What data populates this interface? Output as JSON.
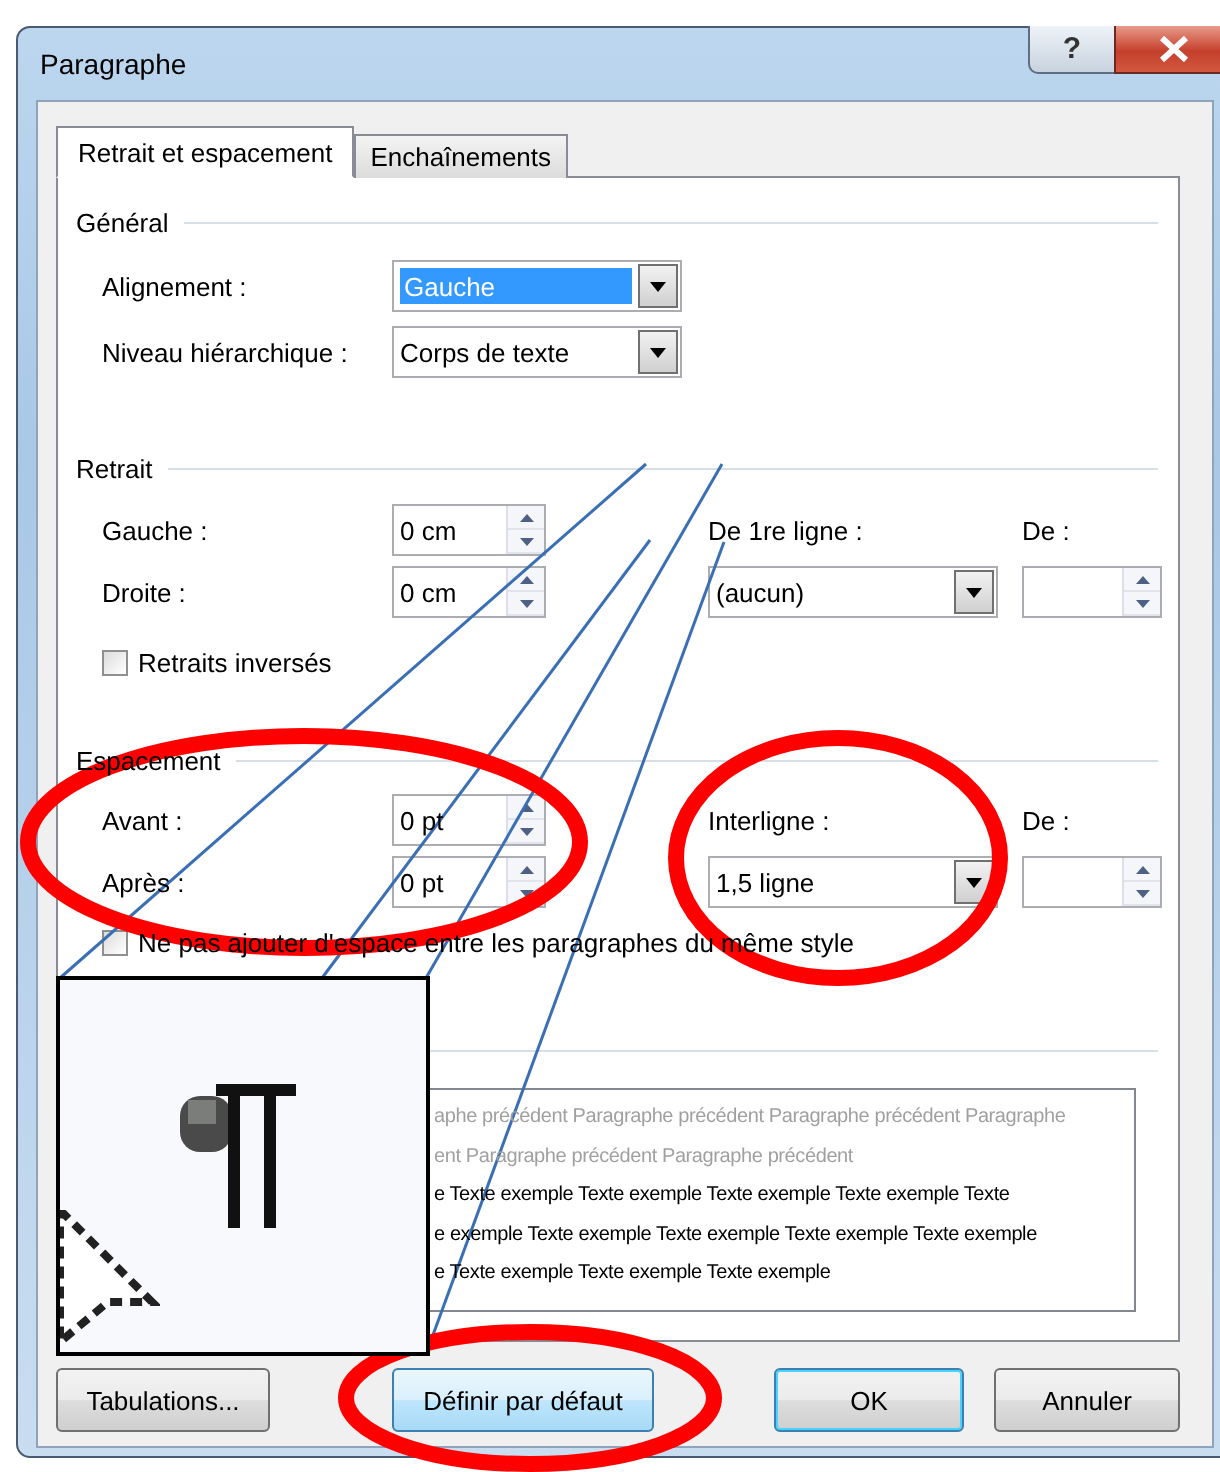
{
  "window": {
    "title": "Paragraphe",
    "help": "?"
  },
  "tabs": [
    {
      "label": "Retrait et espacement",
      "selected": true
    },
    {
      "label": "Enchaînements",
      "selected": false
    }
  ],
  "general": {
    "heading": "Général",
    "alignment": {
      "label": "Alignement :",
      "value": "Gauche",
      "highlighted": true
    },
    "outline_level": {
      "label": "Niveau hiérarchique :",
      "value": "Corps de texte",
      "highlighted": false
    }
  },
  "indentation": {
    "heading": "Retrait",
    "left": {
      "label": "Gauche :",
      "value": "0 cm"
    },
    "right": {
      "label": "Droite :",
      "value": "0 cm"
    },
    "special": {
      "label": "De 1re ligne :",
      "value": "(aucun)"
    },
    "by": {
      "label": "De :"
    },
    "mirror": {
      "label": "Retraits inversés",
      "checked": false
    }
  },
  "spacing": {
    "heading": "Espacement",
    "before": {
      "label": "Avant :",
      "value": "0 pt"
    },
    "after": {
      "label": "Après :",
      "value": "0 pt"
    },
    "line_spacing": {
      "label": "Interligne :",
      "value": "1,5 ligne"
    },
    "at": {
      "label": "De :"
    },
    "dont_add": {
      "label": "Ne pas ajouter d'espace entre les paragraphes du même style",
      "checked": false
    }
  },
  "preview": {
    "lines": [
      {
        "kind": "previous",
        "text": "aphe précédent Paragraphe précédent Paragraphe précédent Paragraphe"
      },
      {
        "kind": "previous",
        "text": "ent Paragraphe précédent Paragraphe précédent"
      },
      {
        "kind": "sample",
        "text": "e Texte exemple Texte exemple Texte exemple Texte exemple Texte"
      },
      {
        "kind": "sample",
        "text": "e exemple Texte exemple Texte exemple Texte exemple Texte exemple"
      },
      {
        "kind": "sample",
        "text": "e Texte exemple Texte exemple Texte exemple"
      }
    ]
  },
  "buttons": [
    {
      "label": "Tabulations...",
      "default": false,
      "hovered": false
    },
    {
      "label": "Définir par défaut",
      "default": false,
      "hovered": true
    },
    {
      "label": "OK",
      "default": true,
      "hovered": false
    },
    {
      "label": "Annuler",
      "default": false,
      "hovered": false
    }
  ]
}
